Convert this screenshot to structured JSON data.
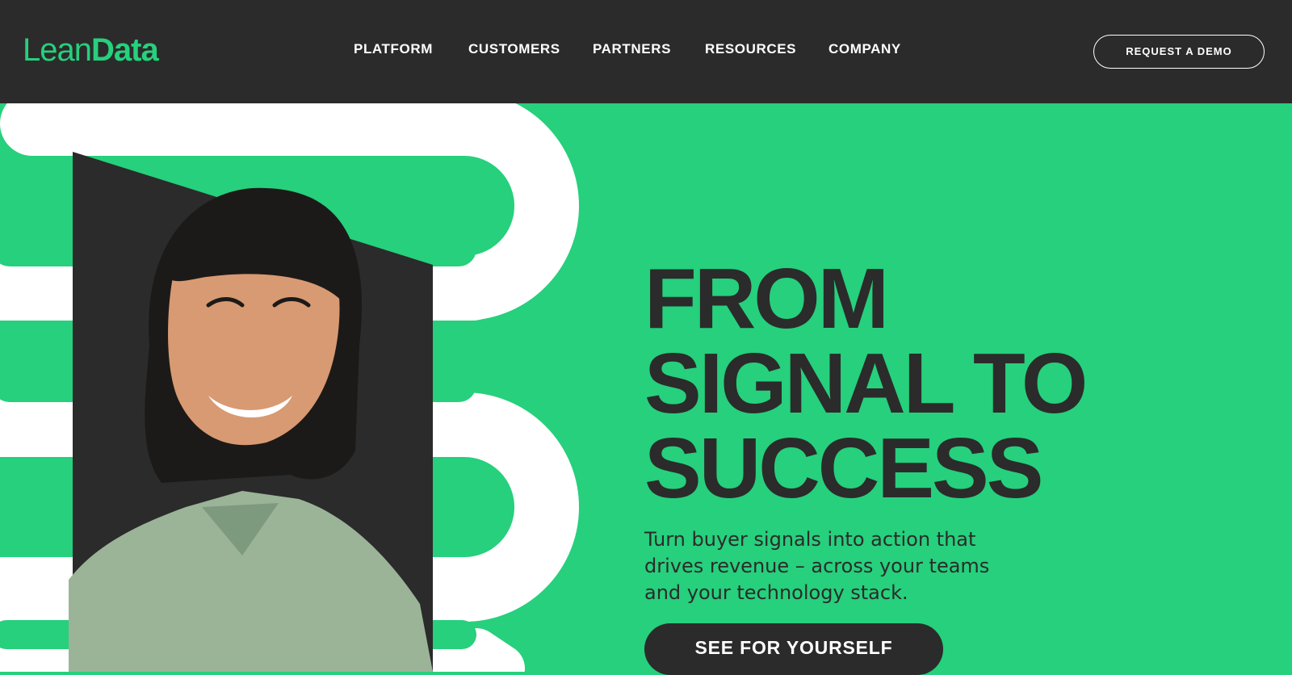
{
  "brand": {
    "logo_light": "Lean",
    "logo_bold": "Data"
  },
  "nav": {
    "items": [
      {
        "label": "PLATFORM"
      },
      {
        "label": "CUSTOMERS"
      },
      {
        "label": "PARTNERS"
      },
      {
        "label": "RESOURCES"
      },
      {
        "label": "COMPANY"
      }
    ],
    "cta_label": "REQUEST A DEMO"
  },
  "hero": {
    "headline_lines": [
      "FROM",
      "SIGNAL TO",
      "SUCCESS"
    ],
    "subheading": "Turn buyer signals into action that drives revenue – across your teams and your technology stack.",
    "cta_label": "SEE FOR YOURSELF"
  },
  "colors": {
    "brand_green": "#26d07c",
    "dark": "#2b2b2b",
    "white": "#ffffff"
  }
}
